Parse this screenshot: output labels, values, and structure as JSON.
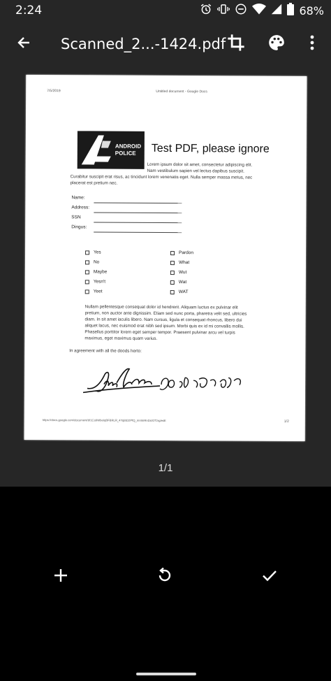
{
  "status": {
    "time": "2:24",
    "battery": "68%"
  },
  "toolbar": {
    "title": "Scanned_2...-1424.pdf"
  },
  "icons": {
    "back": "arrow-left-icon",
    "crop": "crop-icon",
    "palette": "palette-icon",
    "more": "more-vert-icon",
    "add": "add-icon",
    "rotate": "rotate-icon",
    "check": "check-icon"
  },
  "pdf": {
    "header_date": "7/5/2019",
    "header_title": "Untitled document - Google Docs",
    "logo_text_1": "ANDROID",
    "logo_text_2": "POLICE",
    "title": "Test PDF, please ignore",
    "intro_1": "Lorem ipsum dolor sit amet, consectetur adipiscing elit.",
    "intro_2": "Nam vestibulum sapien vel lectus dapibus suscipit.",
    "intro_3": "Curabitur suscipit erat risus, ac tincidunt lorem venenatis eget. Nulla semper massa metus, nec",
    "intro_4": "placerat est pretium nec.",
    "fields": [
      "Name:",
      "Address:",
      "SSN",
      "Dingus:"
    ],
    "options_left": [
      "Yes",
      "No",
      "Maybe",
      "Yesn't",
      "Yeet"
    ],
    "options_right": [
      "Pardon",
      "What",
      "Wut",
      "Wat",
      "WAT"
    ],
    "para_1": "Nullam pellentesque consequat dolor id hendrerit. Aliquam luctus ex pulvinar elit",
    "para_2": "pretium, non auctor ante dignissim. Etiam sed nunc porta, pharetra velit sed, ultricies",
    "para_3": "diam. In sit amet iaculis libero. Nam cursus, ligula et consequat rhoncus, libero dui",
    "para_4": "aliquet lacus, nec euismod erat nibh sed ipsum. Morbi quis ex id mi convallis mollis.",
    "para_5": "Phasellus porttitor lorem eget semper tempor. Praesent pulvinar arcu vel turpis",
    "para_6": "maximus, eget maximus quam varius.",
    "agreement": "In agreement with all the doods herto:",
    "footer_url": "https://docs.google.com/document/d/1Co9WbeIqBFBRLR_4Yq8tO2PfQ_mnhhRnDs/OTzrg/edit",
    "footer_page": "1/2"
  },
  "page_indicator": "1/1"
}
